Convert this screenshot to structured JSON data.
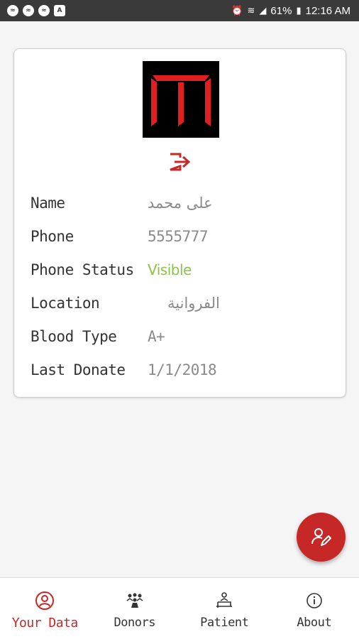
{
  "status_bar": {
    "battery": "61%",
    "time": "12:16 AM",
    "left_icons": [
      "messenger-icon",
      "messenger-icon",
      "messenger-icon",
      "app-icon"
    ],
    "right_icons": [
      "alarm-icon",
      "wifi-icon",
      "signal-icon",
      "battery-icon"
    ]
  },
  "profile": {
    "logo_letter": "m",
    "logo_color": "#e02020",
    "logout_icon": "logout-icon",
    "rows": [
      {
        "label": "Name",
        "value": "علی محمد"
      },
      {
        "label": "Phone",
        "value": "5555777"
      },
      {
        "label": "Phone Status",
        "value": "Visible"
      },
      {
        "label": "Location",
        "value": "الفروانية"
      },
      {
        "label": "Blood Type",
        "value": "A+"
      },
      {
        "label": "Last Donate",
        "value": "1/1/2018"
      }
    ]
  },
  "fab": {
    "icon": "edit-user-icon",
    "color": "#c62828"
  },
  "bottom_nav": {
    "items": [
      {
        "label": "Your Data",
        "icon": "user-circle-icon",
        "active": true
      },
      {
        "label": "Donors",
        "icon": "group-icon",
        "active": false
      },
      {
        "label": "Patient",
        "icon": "patient-bed-icon",
        "active": false
      },
      {
        "label": "About",
        "icon": "info-icon",
        "active": false
      }
    ]
  },
  "colors": {
    "accent": "#c62828",
    "visible": "#8bc34a",
    "status_bar": "#3a3a3a"
  }
}
